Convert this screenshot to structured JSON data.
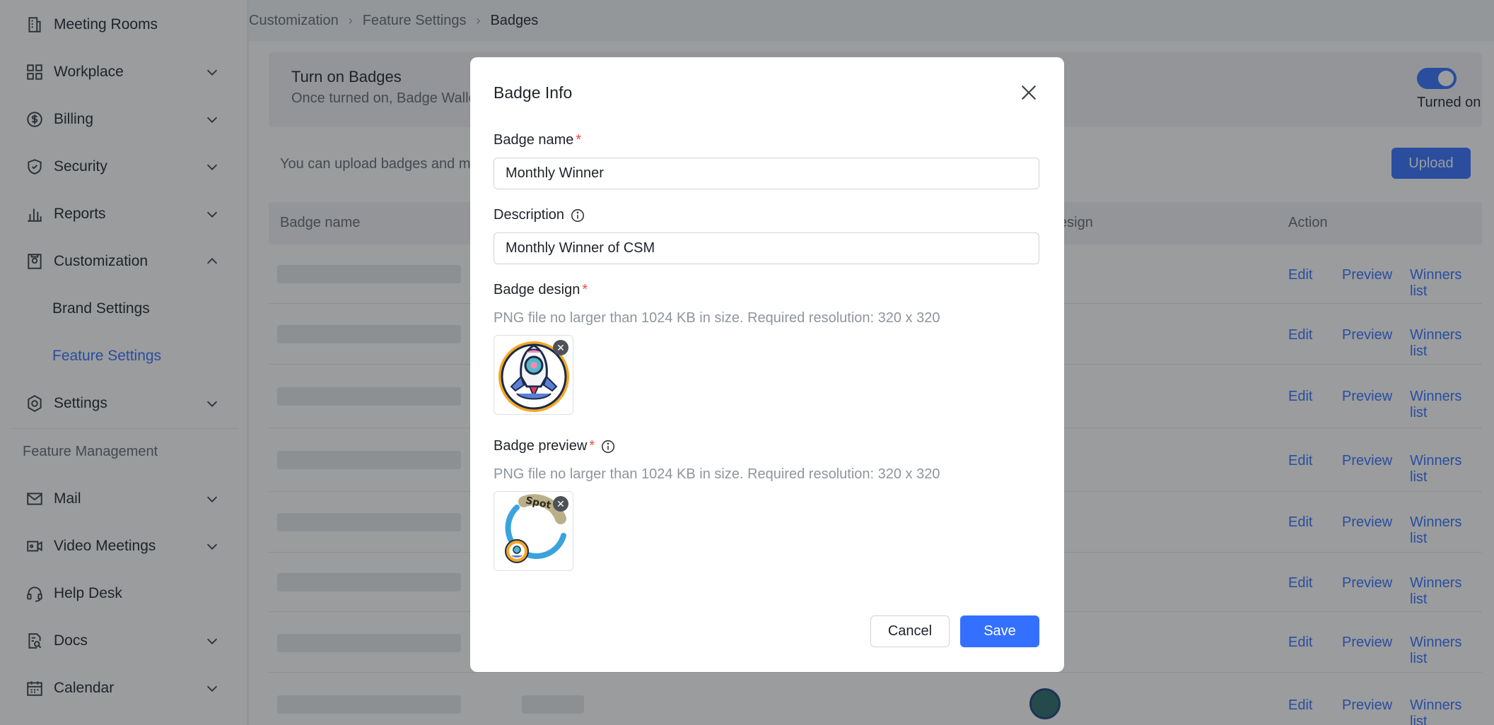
{
  "sidebar": {
    "items": [
      {
        "label": "Meeting Rooms",
        "icon": "building-icon"
      },
      {
        "label": "Workplace",
        "icon": "grid-icon"
      },
      {
        "label": "Billing",
        "icon": "dollar-icon"
      },
      {
        "label": "Security",
        "icon": "shield-icon"
      },
      {
        "label": "Reports",
        "icon": "bar-chart-icon"
      },
      {
        "label": "Customization",
        "icon": "customize-icon"
      },
      {
        "label": "Settings",
        "icon": "gear-icon"
      }
    ],
    "subitems": [
      {
        "label": "Brand Settings"
      },
      {
        "label": "Feature Settings"
      }
    ],
    "section_title": "Feature Management",
    "items2": [
      {
        "label": "Mail",
        "icon": "mail-icon"
      },
      {
        "label": "Video Meetings",
        "icon": "video-icon"
      },
      {
        "label": "Help Desk",
        "icon": "headset-icon"
      },
      {
        "label": "Docs",
        "icon": "doc-search-icon"
      },
      {
        "label": "Calendar",
        "icon": "calendar-icon"
      }
    ]
  },
  "breadcrumb": [
    "Customization",
    "Feature Settings",
    "Badges"
  ],
  "banner": {
    "title": "Turn on Badges",
    "subtitle": "Once turned on, Badge Walle",
    "toggle_label": "Turned on"
  },
  "hint": "You can upload badges and ma",
  "upload_label": "Upload",
  "table": {
    "headers": [
      "Badge name",
      "esign",
      "Action"
    ],
    "actions": [
      "Edit",
      "Preview",
      "Winners list"
    ]
  },
  "modal": {
    "title": "Badge Info",
    "name_label": "Badge name",
    "name_value": "Monthly Winner",
    "desc_label": "Description",
    "desc_value": "Monthly Winner of CSM",
    "design_label": "Badge design",
    "design_hint": "PNG file no larger than 1024 KB in size. Required resolution: 320 x 320",
    "preview_label": "Badge preview",
    "preview_hint": "PNG file no larger than 1024 KB in size. Required resolution: 320 x 320",
    "cancel_label": "Cancel",
    "save_label": "Save",
    "required_mark": "*",
    "preview_image_text": "Spot"
  },
  "colors": {
    "accent": "#3370ff",
    "required": "#f54a45"
  }
}
